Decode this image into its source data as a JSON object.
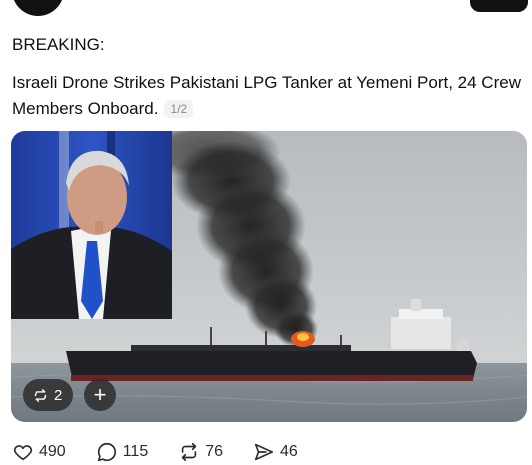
{
  "post": {
    "label": "BREAKING:",
    "headline": "Israeli Drone Strikes Pakistani LPG Tanker at Yemeni Port, 24 Crew Members Onboard.",
    "page_indicator": "1/2"
  },
  "media": {
    "image_description": "photo of a tanker ship emitting black smoke at sea, with an inset portrait of a man in a suit",
    "repost_count": "2",
    "add_symbol": "+"
  },
  "actions": {
    "likes": "490",
    "replies": "115",
    "reposts": "76",
    "shares": "46"
  },
  "icons": {
    "like": "heart-icon",
    "reply": "speech-bubble-icon",
    "repost": "repost-arrows-icon",
    "share": "send-arrow-icon"
  }
}
